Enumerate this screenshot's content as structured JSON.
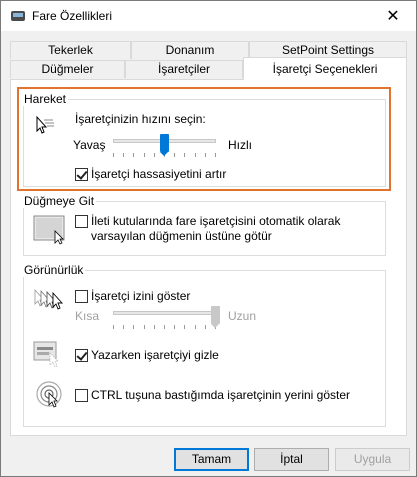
{
  "window": {
    "title": "Fare Özellikleri"
  },
  "tabs_back": [
    {
      "label": "Tekerlek"
    },
    {
      "label": "Donanım"
    },
    {
      "label": "SetPoint Settings"
    }
  ],
  "tabs_front": [
    {
      "label": "Düğmeler"
    },
    {
      "label": "İşaretçiler"
    },
    {
      "label": "İşaretçi Seçenekleri",
      "active": true
    }
  ],
  "motion": {
    "group_title": "Hareket",
    "speed_prompt": "İşaretçinizin hızını seçin:",
    "slow_label": "Yavaş",
    "fast_label": "Hızlı",
    "speed_level": 0.5,
    "precision_label": "İşaretçi hassasiyetini artır",
    "precision_checked": true
  },
  "snap_to": {
    "group_title": "Düğmeye Git",
    "label_line1": "İleti kutularında fare işaretçisini otomatik olarak",
    "label_line2": "varsayılan düğmenin üstüne götür",
    "checked": false
  },
  "visibility": {
    "group_title": "Görünürlük",
    "trails_label": "İşaretçi izini göster",
    "trails_checked": false,
    "short_label": "Kısa",
    "long_label": "Uzun",
    "trails_level": 1.0,
    "hide_label": "Yazarken işaretçiyi gizle",
    "hide_checked": true,
    "ctrl_label": "CTRL tuşuna bastığımda işaretçinin yerini göster",
    "ctrl_checked": false
  },
  "buttons": {
    "ok": "Tamam",
    "cancel": "İptal",
    "apply": "Uygula"
  },
  "colors": {
    "accent": "#0078d7",
    "highlight": "#e0732e"
  }
}
